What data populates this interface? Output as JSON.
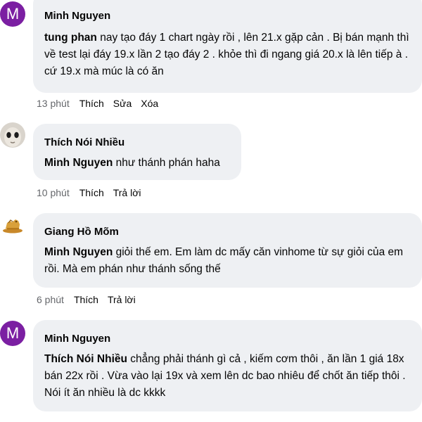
{
  "comments": [
    {
      "avatar_letter": "M",
      "author": "Minh Nguyen",
      "mention": "tung phan",
      "text": " nay tạo đáy 1 chart ngày rồi , lên 21.x gặp cản . Bị bán mạnh thì về test lại đáy 19.x lần 2 tạo đáy 2 . khỏe thì đi ngang giá 20.x là lên tiếp à . cứ 19.x mà múc là có ăn",
      "time": "13 phút",
      "actions": [
        "Thích",
        "Sửa",
        "Xóa"
      ]
    },
    {
      "avatar_icon": "alien-face-avatar",
      "author": "Thích Nói Nhiều",
      "mention": "Minh Nguyen",
      "text": " như thánh phán haha",
      "time": "10 phút",
      "actions": [
        "Thích",
        "Trả lời"
      ]
    },
    {
      "avatar_icon": "golden-horse-avatar",
      "author": "Giang Hồ Mõm",
      "mention": "Minh Nguyen",
      "text": " giỏi thế em. Em làm dc mấy căn vinhome từ sự giỏi của em rồi. Mà em phán như thánh sống thế",
      "time": "6 phút",
      "actions": [
        "Thích",
        "Trả lời"
      ]
    },
    {
      "avatar_letter": "M",
      "author": "Minh Nguyen",
      "mention": "Thích Nói Nhiều",
      "text": " chẳng phải thánh gì cả , kiếm cơm thôi , ăn lần 1 giá 18x bán 22x rồi . Vừa vào lại 19x và xem lên dc bao nhiêu để chốt ăn tiếp thôi . Nói ít ăn nhiều là dc kkkk"
    }
  ],
  "colors": {
    "bubble_bg": "#eef0f3",
    "avatar_purple": "#7b1fa2",
    "meta_gray": "#65676b"
  }
}
